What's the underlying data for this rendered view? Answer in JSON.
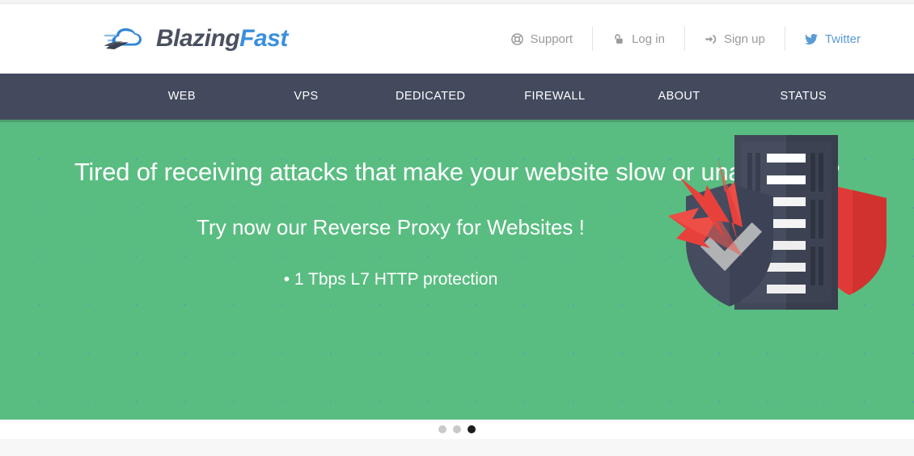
{
  "brand": {
    "name_part1": "Blazing",
    "name_part2": "Fast",
    "logo_icon": "cloud-speed-icon",
    "color_dark": "#4a5060",
    "color_blue": "#3a8fdd"
  },
  "header": {
    "links": [
      {
        "label": "Support",
        "icon": "lifebuoy-icon"
      },
      {
        "label": "Log in",
        "icon": "open-padlock-icon"
      },
      {
        "label": "Sign up",
        "icon": "sign-in-arrow-icon"
      },
      {
        "label": "Twitter",
        "icon": "twitter-bird-icon",
        "color": "#5b9bd5"
      }
    ]
  },
  "mainnav": {
    "background": "#434a5e",
    "accent": "#4e9e6d",
    "items": [
      {
        "label": "WEB"
      },
      {
        "label": "VPS"
      },
      {
        "label": "DEDICATED"
      },
      {
        "label": "FIREWALL"
      },
      {
        "label": "ABOUT"
      },
      {
        "label": "STATUS"
      }
    ]
  },
  "hero": {
    "background": "#59bd81",
    "headline": "Tired of receiving attacks that make your website slow or unavailable?",
    "subheadline": "Try now our Reverse Proxy for Websites !",
    "bullet": "• 1 Tbps L7 HTTP protection",
    "illustration": "server-shield-attack-icon",
    "colors": {
      "server_light": "#414859",
      "server_dark": "#383e4d",
      "shield_navy": "#454c60",
      "shield_red": "#e03a38",
      "arrow_red": "#e8413c",
      "check_gray": "#b0b2b4"
    }
  },
  "carousel": {
    "slides": 3,
    "active_index": 2,
    "dot_color": "#c9c9c9",
    "active_dot_color": "#1d1d1d"
  }
}
